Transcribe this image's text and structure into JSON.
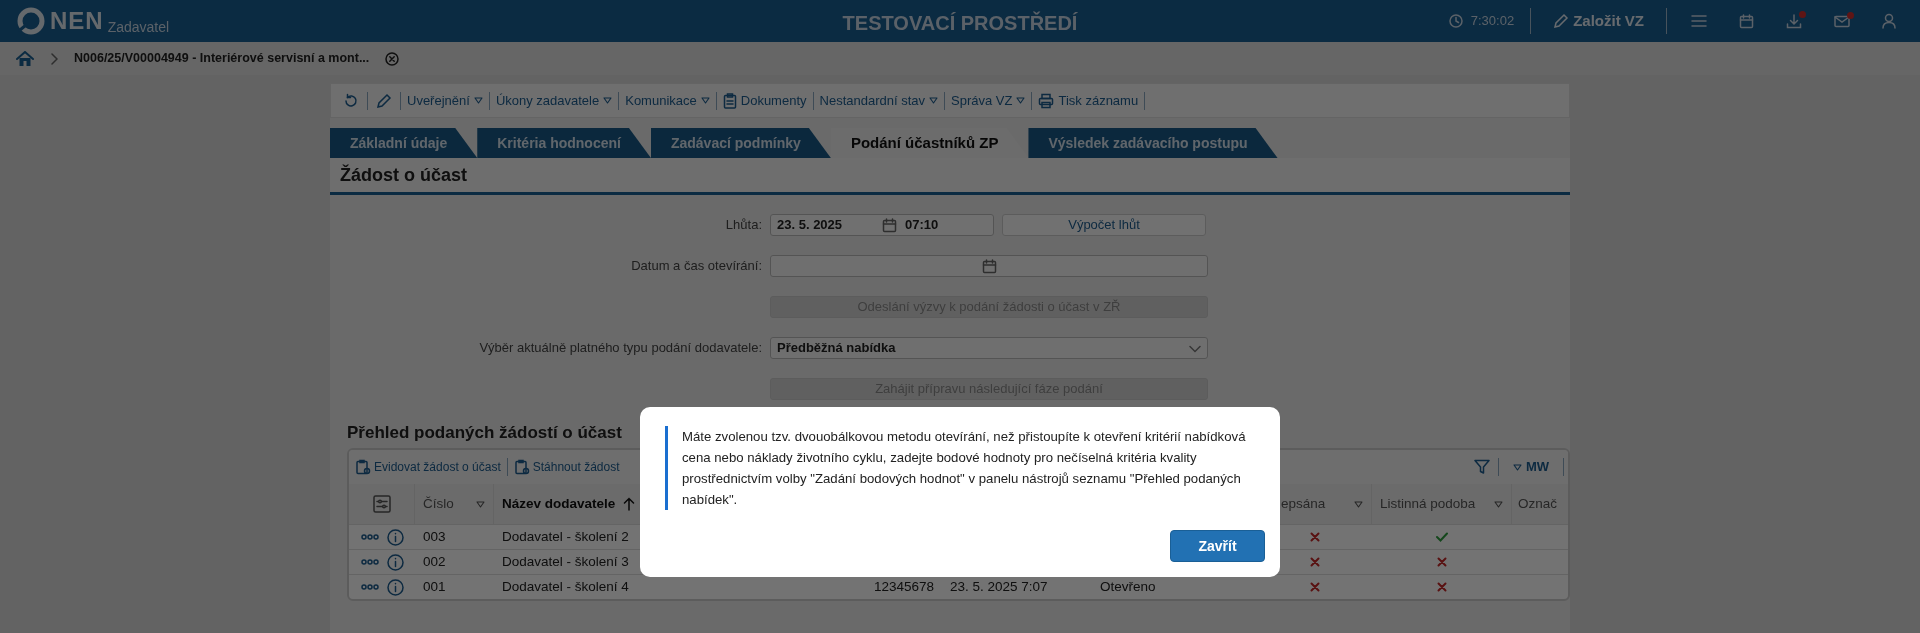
{
  "header": {
    "brand": "NEN",
    "subtitle": "Zadavatel",
    "environment": "TESTOVACÍ PROSTŘEDÍ",
    "clock": "7:30:02",
    "create_label": "Založit VZ",
    "icons": [
      {
        "kind": "menu",
        "badge": false
      },
      {
        "kind": "calendar",
        "badge": false
      },
      {
        "kind": "download",
        "badge": true
      },
      {
        "kind": "mail",
        "badge": true
      },
      {
        "kind": "user",
        "badge": false
      }
    ]
  },
  "breadcrumb": {
    "title": "N006/25/V00004949 - Interiérové servisní a mont..."
  },
  "toolbar": [
    {
      "kind": "refresh"
    },
    {
      "kind": "edit"
    },
    {
      "label": "Uveřejnění",
      "dropdown": true
    },
    {
      "label": "Úkony zadavatele",
      "dropdown": true
    },
    {
      "label": "Komunikace",
      "dropdown": true
    },
    {
      "label": "Dokumenty",
      "kind": "clipboard",
      "dropdown": false
    },
    {
      "label": "Nestandardní stav",
      "dropdown": true
    },
    {
      "label": "Správa VZ",
      "dropdown": true
    },
    {
      "label": "Tisk záznamu",
      "kind": "printer",
      "dropdown": false
    }
  ],
  "tabs": [
    {
      "label": "Základní údaje",
      "selected": false
    },
    {
      "label": "Kritéria hodnocení",
      "selected": false
    },
    {
      "label": "Zadávací podmínky",
      "selected": false
    },
    {
      "label": "Podání účastníků ZP",
      "selected": true
    },
    {
      "label": "Výsledek zadávacího postupu",
      "selected": false
    }
  ],
  "section_title": "Žádost o účast",
  "form": [
    {
      "kind": "deadline",
      "label": "Lhůta:",
      "date": "23. 5. 2025",
      "time": "07:10",
      "button": "Výpočet lhůt"
    },
    {
      "kind": "datetime",
      "label": "Datum a čas otevírání:"
    },
    {
      "kind": "button",
      "label": "Odeslání výzvy k podání žádosti o účast v ZŘ",
      "disabled": true
    },
    {
      "kind": "select",
      "label": "Výběr aktuálně platného typu podání dodavatele:",
      "value": "Předběžná nabídka"
    },
    {
      "kind": "button",
      "label": "Zahájit přípravu následující fáze podání",
      "disabled": true
    }
  ],
  "list": {
    "title": "Přehled podaných žádostí o účast",
    "actions": [
      {
        "label": "Evidovat žádost o účast"
      },
      {
        "label": "Stáhnout žádost"
      }
    ],
    "view": "MW",
    "columns": [
      {
        "label": "Číslo",
        "sorted": false
      },
      {
        "label": "Název dodavatele",
        "sorted": true
      },
      {
        "label": "epsána",
        "sorted": false
      },
      {
        "label": "Listinná podoba",
        "sorted": false
      },
      {
        "label": "Označ"
      }
    ],
    "rows": [
      {
        "number": "003",
        "supplier": "Dodavatel - školení 2",
        "signed": false,
        "paper": true
      },
      {
        "number": "002",
        "supplier": "Dodavatel - školení 3",
        "signed": false,
        "paper": false
      },
      {
        "number": "001",
        "supplier": "Dodavatel - školení 4",
        "column_4": "12345678",
        "column_5": "23. 5. 2025 7:07",
        "column_6": "Otevřeno",
        "signed": false,
        "paper": false
      }
    ]
  },
  "dialog": {
    "message": "Máte zvolenou tzv. dvouobálkovou metodu otevírání, než přistoupíte k otevření kritérií nabídková cena nebo náklady životního cyklu, zadejte bodové hodnoty pro nečíselná kritéria kvality prostřednictvím volby \"Zadání bodových hodnot\" v panelu nástrojů seznamu \"Přehled podaných nabídek\".",
    "button": "Zavřít"
  }
}
